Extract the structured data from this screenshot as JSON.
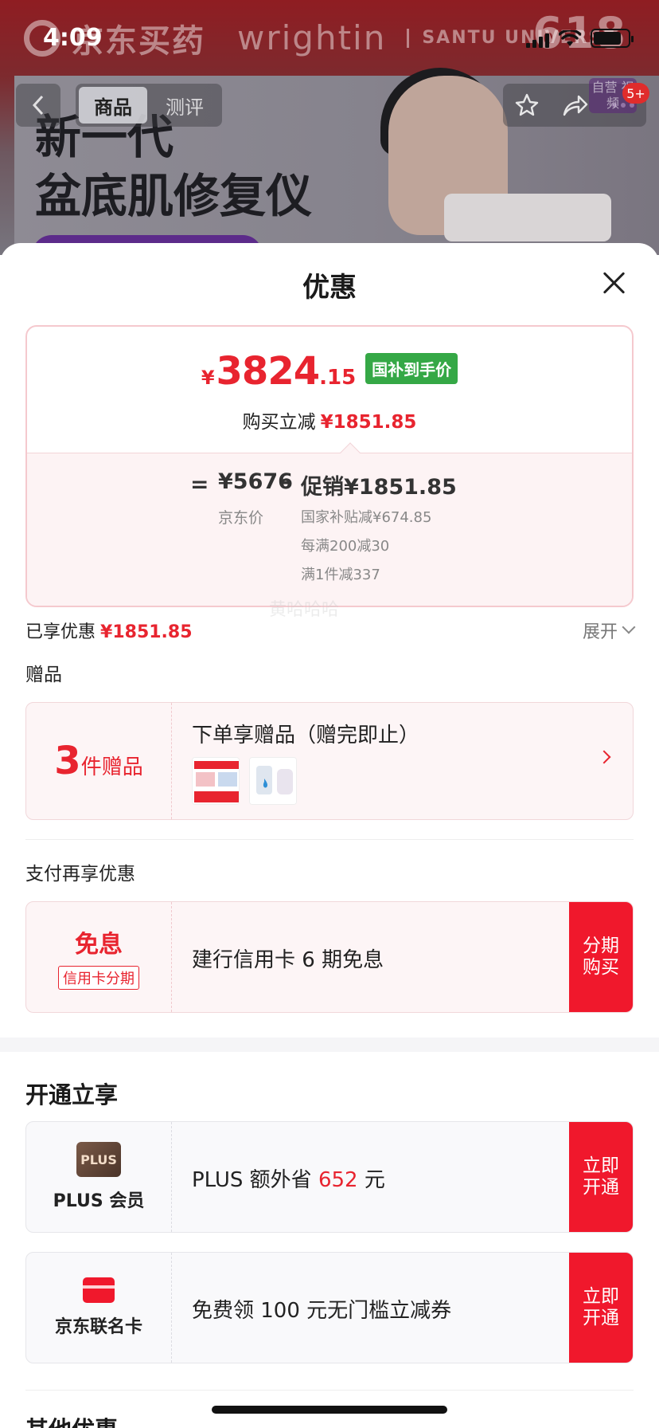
{
  "status_bar": {
    "time": "4:09"
  },
  "background": {
    "brand_name": "京东买药",
    "brand_partner": "wrightin",
    "brand_partner_2": "SANTU UNIVERSE",
    "brand_event": "618",
    "hero_title_line1": "新一代",
    "hero_title_line2": "盆底肌修复仪",
    "nav_tabs": [
      {
        "label": "商品"
      },
      {
        "label": "测评"
      }
    ],
    "side_label": "自营 视频",
    "cart_badge": "5+"
  },
  "sheet": {
    "title": "优惠",
    "price_card": {
      "currency": "¥",
      "price_int": "3824",
      "price_dec": ".15",
      "price_tag": "国补到手价",
      "reduce_label": "购买立减",
      "reduce_value": "¥1851.85",
      "calc_eq": "=",
      "base_price": "¥5676",
      "base_label": "京东价",
      "minus": "–",
      "promo_total": "促销¥1851.85",
      "promo_items": [
        "国家补贴减¥674.85",
        "每满200减30",
        "满1件减337"
      ]
    },
    "enjoyed_label": "已享优惠",
    "enjoyed_value": "¥1851.85",
    "expand_label": "展开",
    "gift_section_label": "赠品",
    "watermark": "黄哈哈哈",
    "gift_card": {
      "count": "3",
      "unit": "件赠品",
      "title": "下单享赠品（赠完即止）"
    },
    "pay_section_label": "支付再享优惠",
    "installment_card": {
      "main": "免息",
      "sub": "信用卡分期",
      "text": "建行信用卡 6 期免息",
      "button": "分期\n购买"
    },
    "open_section_label": "开通立享",
    "plus_card": {
      "badge": "PLUS",
      "label": "PLUS 会员",
      "text_prefix": "PLUS 额外省 ",
      "text_amount": "652",
      "text_suffix": " 元",
      "button": "立即\n开通"
    },
    "jdcard_card": {
      "label": "京东联名卡",
      "text": "免费领 100 元无门槛立减券",
      "button": "立即\n开通"
    },
    "other_section_label": "其他优惠"
  }
}
